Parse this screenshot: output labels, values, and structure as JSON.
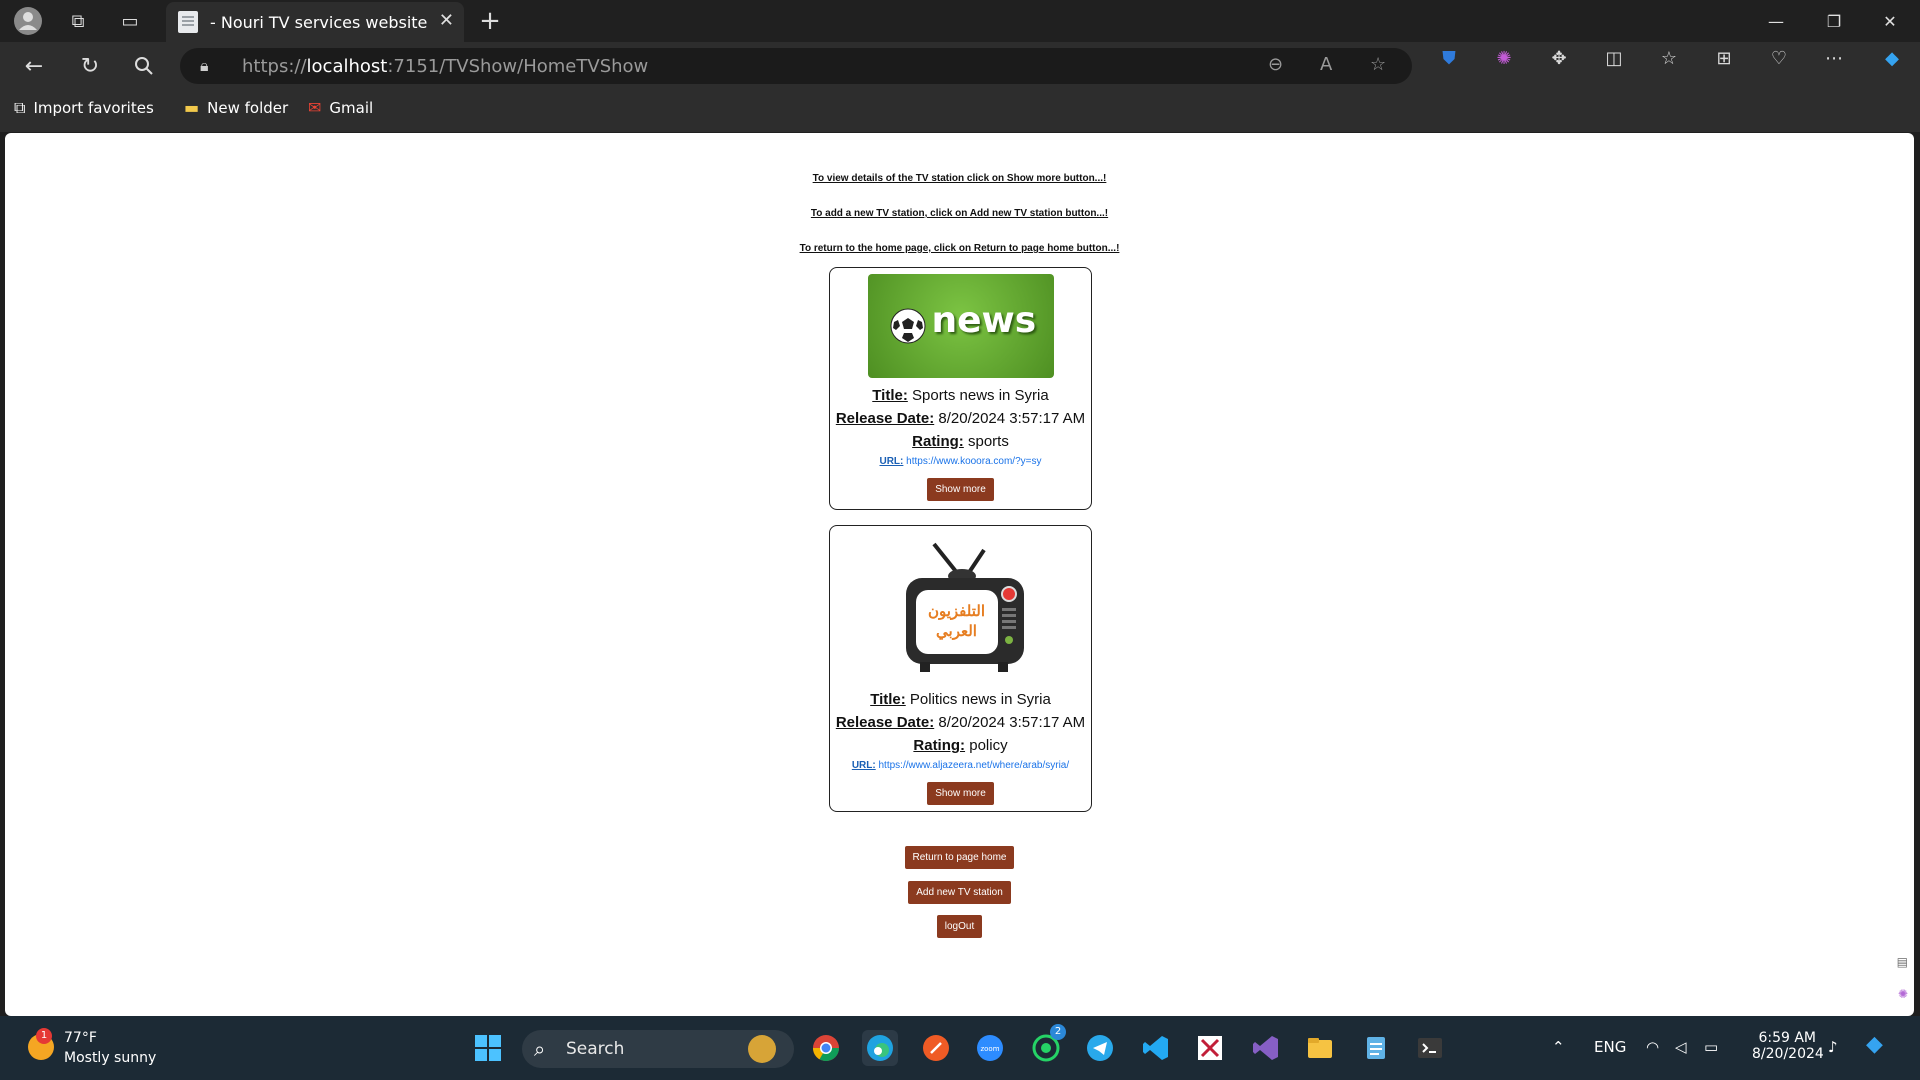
{
  "browser": {
    "tab_title": "- Nouri TV services website",
    "url_host": "localhost",
    "url_prefix": "https://",
    "url_rest": ":7151/TVShow/HomeTVShow"
  },
  "favorites": [
    {
      "label": "Import favorites",
      "icon": "import-icon"
    },
    {
      "label": "New folder",
      "icon": "folder-icon"
    },
    {
      "label": "Gmail",
      "icon": "gmail-icon"
    }
  ],
  "hints": [
    "To view details of the TV station click on Show more button...!",
    "To add a new TV station, click on Add new TV station button...!",
    "To return to the home page, click on Return to page home button...!"
  ],
  "cards": [
    {
      "image_text": "news",
      "title_label": "Title:",
      "title": "Sports news in Syria",
      "release_label": "Release Date:",
      "release": "8/20/2024 3:57:17 AM",
      "rating_label": "Rating:",
      "rating": "sports",
      "url_label": "URL:",
      "url": "https://www.kooora.com/?y=sy",
      "button": "Show more"
    },
    {
      "image_text": "التلفزيون العربي",
      "title_label": "Title:",
      "title": "Politics news in Syria",
      "release_label": "Release Date:",
      "release": "8/20/2024 3:57:17 AM",
      "rating_label": "Rating:",
      "rating": "policy",
      "url_label": "URL:",
      "url": "https://www.aljazeera.net/where/arab/syria/",
      "button": "Show more"
    }
  ],
  "actions": {
    "return_home": "Return to page home",
    "add_station": "Add new TV station",
    "logout": "logOut"
  },
  "taskbar": {
    "temperature": "77°F",
    "weather": "Mostly sunny",
    "weather_badge": "1",
    "search_placeholder": "Search",
    "whatsapp_badge": "2",
    "language": "ENG",
    "time": "6:59 AM",
    "date": "8/20/2024"
  },
  "colors": {
    "button_bg": "#8b3a1f",
    "news_green": "#5da22b",
    "link_blue": "#1a73e8"
  }
}
